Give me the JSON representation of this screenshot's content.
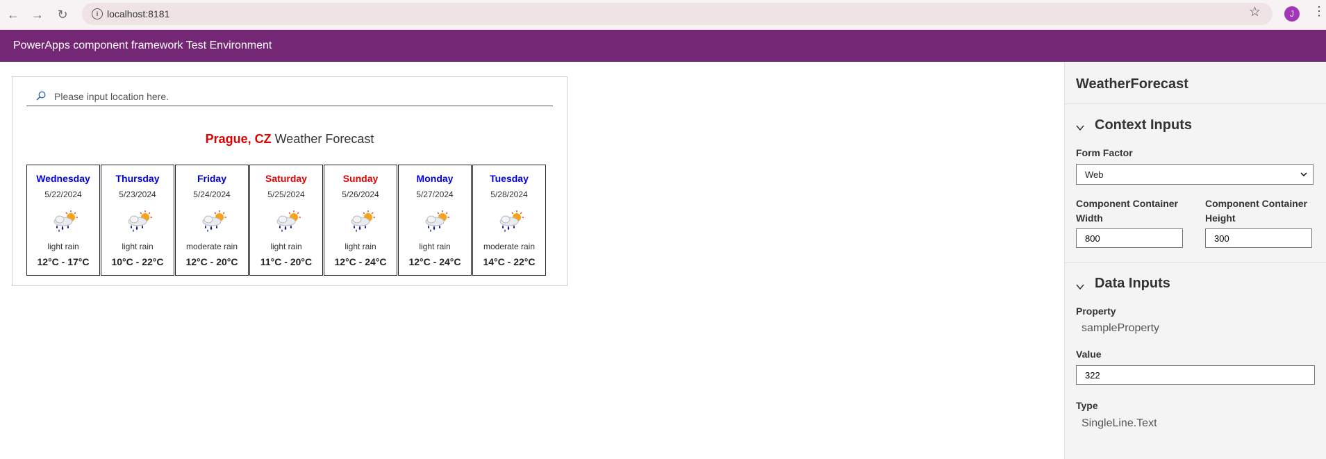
{
  "browser": {
    "url": "localhost:8181",
    "avatar_letter": "J",
    "back_icon": "←",
    "forward_icon": "→",
    "reload_icon": "↻",
    "info_icon": "i",
    "star_icon": "☆",
    "menu_icon": "⋮"
  },
  "app": {
    "title": "PowerApps component framework Test Environment"
  },
  "component": {
    "search_placeholder": "Please input location here.",
    "city": "Prague, CZ",
    "heading_suffix": " Weather Forecast",
    "days": [
      {
        "name": "Wednesday",
        "date": "5/22/2024",
        "desc": "light rain",
        "temp": "12°C - 17°C",
        "color": "#0000dd"
      },
      {
        "name": "Thursday",
        "date": "5/23/2024",
        "desc": "light rain",
        "temp": "10°C - 22°C",
        "color": "#0000dd"
      },
      {
        "name": "Friday",
        "date": "5/24/2024",
        "desc": "moderate rain",
        "temp": "12°C - 20°C",
        "color": "#0000dd"
      },
      {
        "name": "Saturday",
        "date": "5/25/2024",
        "desc": "light rain",
        "temp": "11°C - 20°C",
        "color": "#e00000"
      },
      {
        "name": "Sunday",
        "date": "5/26/2024",
        "desc": "light rain",
        "temp": "12°C - 24°C",
        "color": "#e00000"
      },
      {
        "name": "Monday",
        "date": "5/27/2024",
        "desc": "light rain",
        "temp": "12°C - 24°C",
        "color": "#0000dd"
      },
      {
        "name": "Tuesday",
        "date": "5/28/2024",
        "desc": "moderate rain",
        "temp": "14°C - 22°C",
        "color": "#0000dd"
      }
    ]
  },
  "sidebar": {
    "title": "WeatherForecast",
    "context_inputs": {
      "title": "Context Inputs",
      "form_factor_label": "Form Factor",
      "form_factor_value": "Web",
      "width_label": "Component Container Width",
      "width_value": "800",
      "height_label": "Component Container Height",
      "height_value": "300"
    },
    "data_inputs": {
      "title": "Data Inputs",
      "property_label": "Property",
      "property_value": "sampleProperty",
      "value_label": "Value",
      "value_value": "322",
      "type_label": "Type",
      "type_value": "SingleLine.Text"
    }
  }
}
